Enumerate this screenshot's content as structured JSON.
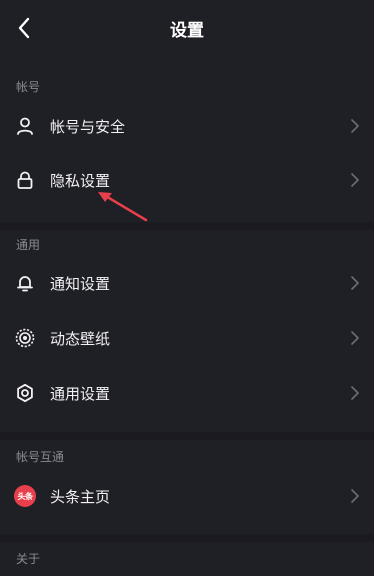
{
  "header": {
    "title": "设置"
  },
  "sections": [
    {
      "label": "帐号",
      "items": [
        {
          "label": "帐号与安全",
          "icon": "user-icon"
        },
        {
          "label": "隐私设置",
          "icon": "lock-icon"
        }
      ]
    },
    {
      "label": "通用",
      "items": [
        {
          "label": "通知设置",
          "icon": "bell-icon"
        },
        {
          "label": "动态壁纸",
          "icon": "wallpaper-icon"
        },
        {
          "label": "通用设置",
          "icon": "gear-icon"
        }
      ]
    },
    {
      "label": "帐号互通",
      "items": [
        {
          "label": "头条主页",
          "icon": "toutiao-icon",
          "badge_text": "头条"
        }
      ]
    },
    {
      "label": "关于",
      "items": []
    }
  ],
  "colors": {
    "background": "#1f1f26",
    "annotation": "#e8404a",
    "badge": "#e8404a"
  }
}
